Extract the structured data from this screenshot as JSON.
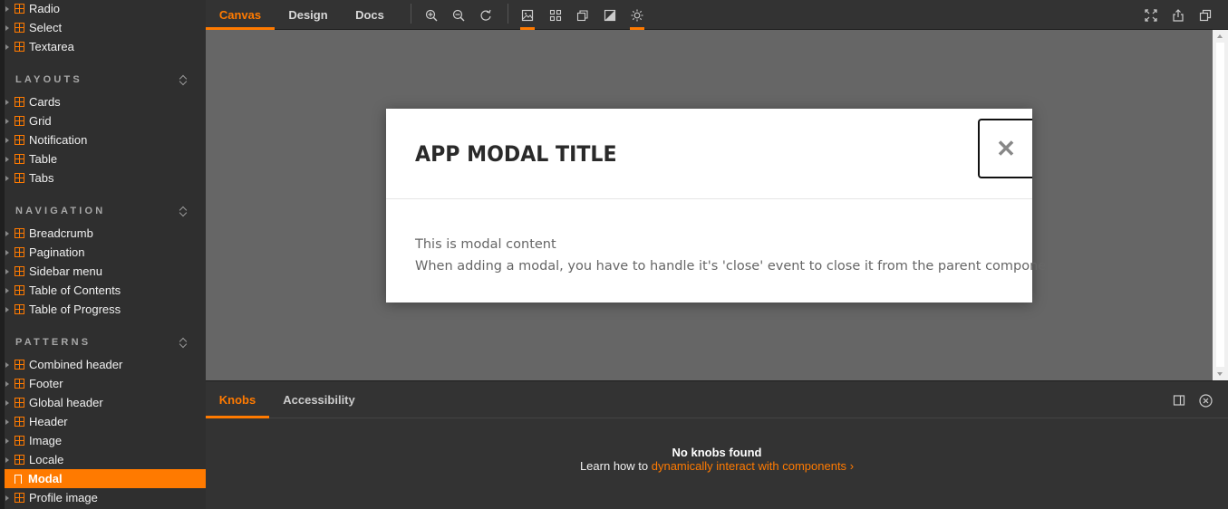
{
  "sidebar": {
    "items_top": [
      {
        "label": "Radio"
      },
      {
        "label": "Select"
      },
      {
        "label": "Textarea"
      }
    ],
    "sections": [
      {
        "title": "LAYOUTS",
        "items": [
          "Cards",
          "Grid",
          "Notification",
          "Table",
          "Tabs"
        ]
      },
      {
        "title": "NAVIGATION",
        "items": [
          "Breadcrumb",
          "Pagination",
          "Sidebar menu",
          "Table of Contents",
          "Table of Progress"
        ]
      },
      {
        "title": "PATTERNS",
        "items": [
          "Combined header",
          "Footer",
          "Global header",
          "Header",
          "Image",
          "Locale",
          "Modal",
          "Profile image"
        ]
      }
    ],
    "active_item": "Modal"
  },
  "toolbar": {
    "tabs": [
      "Canvas",
      "Design",
      "Docs"
    ],
    "active_tab": "Canvas",
    "icons": [
      "zoom-in-icon",
      "zoom-out-icon",
      "reset-zoom-icon",
      "background-icon",
      "grid-icon",
      "viewport-icon",
      "contrast-icon",
      "theme-icon",
      "fullscreen-icon",
      "share-icon",
      "copy-icon"
    ]
  },
  "modal": {
    "title": "APP MODAL TITLE",
    "close_symbol": "✕",
    "body_line1": "This is modal content",
    "body_line2": "When adding a modal, you have to handle it's 'close' event to close it from the parent component."
  },
  "addons": {
    "tabs": [
      "Knobs",
      "Accessibility"
    ],
    "active_tab": "Knobs",
    "empty_title": "No knobs found",
    "learn_prefix": "Learn how to ",
    "learn_link": "dynamically interact with components",
    "learn_chevron": "›"
  },
  "colors": {
    "accent": "#ff7a00",
    "sidebar_bg": "#2f2f2f",
    "canvas_bg": "#666666"
  }
}
